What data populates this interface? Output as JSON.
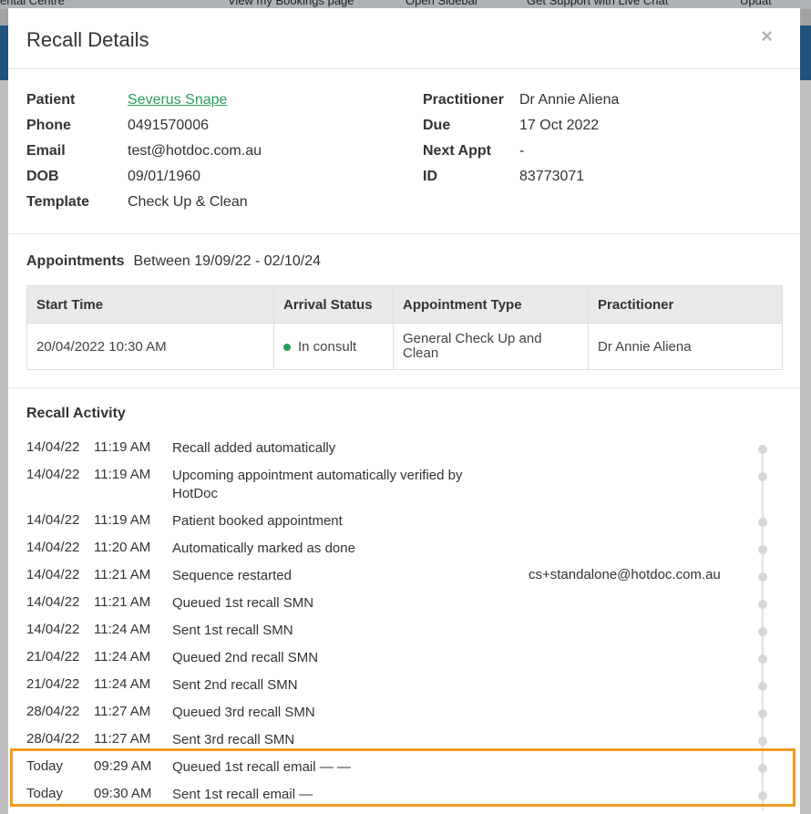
{
  "background": {
    "top_items": [
      "ental Centre",
      "View my Bookings page",
      "Open Sidebar",
      "Get Support with Live Chat",
      "Updat"
    ]
  },
  "modal": {
    "title": "Recall Details",
    "close_icon": "×"
  },
  "details": {
    "left": [
      {
        "label": "Patient",
        "value": "Severus Snape",
        "is_link": true
      },
      {
        "label": "Phone",
        "value": "0491570006"
      },
      {
        "label": "Email",
        "value": "test@hotdoc.com.au"
      },
      {
        "label": "DOB",
        "value": "09/01/1960"
      },
      {
        "label": "Template",
        "value": "Check Up & Clean"
      }
    ],
    "right": [
      {
        "label": "Practitioner",
        "value": "Dr Annie Aliena"
      },
      {
        "label": "Due",
        "value": "17 Oct 2022"
      },
      {
        "label": "Next Appt",
        "value": "-"
      },
      {
        "label": "ID",
        "value": "83773071"
      }
    ]
  },
  "appointments": {
    "heading": "Appointments",
    "range": "Between 19/09/22 - 02/10/24",
    "columns": [
      "Start Time",
      "Arrival Status",
      "Appointment Type",
      "Practitioner"
    ],
    "rows": [
      {
        "start": "20/04/2022 10:30 AM",
        "status": "In consult",
        "type": "General Check Up and Clean",
        "practitioner": "Dr Annie Aliena"
      }
    ],
    "status_color": "#2a9d5c"
  },
  "activity": {
    "heading": "Recall Activity",
    "rows": [
      {
        "date": "14/04/22",
        "time": "11:19 AM",
        "desc": "Recall added automatically",
        "user": ""
      },
      {
        "date": "14/04/22",
        "time": "11:19 AM",
        "desc": "Upcoming appointment automatically verified by HotDoc",
        "user": ""
      },
      {
        "date": "14/04/22",
        "time": "11:19 AM",
        "desc": "Patient booked appointment",
        "user": ""
      },
      {
        "date": "14/04/22",
        "time": "11:20 AM",
        "desc": "Automatically marked as done",
        "user": ""
      },
      {
        "date": "14/04/22",
        "time": "11:21 AM",
        "desc": "Sequence restarted",
        "user": "cs+standalone@hotdoc.com.au"
      },
      {
        "date": "14/04/22",
        "time": "11:21 AM",
        "desc": "Queued 1st recall SMN",
        "user": ""
      },
      {
        "date": "14/04/22",
        "time": "11:24 AM",
        "desc": "Sent 1st recall SMN",
        "user": ""
      },
      {
        "date": "21/04/22",
        "time": "11:24 AM",
        "desc": "Queued 2nd recall SMN",
        "user": ""
      },
      {
        "date": "21/04/22",
        "time": "11:24 AM",
        "desc": "Sent 2nd recall SMN",
        "user": ""
      },
      {
        "date": "28/04/22",
        "time": "11:27 AM",
        "desc": "Queued 3rd recall SMN",
        "user": ""
      },
      {
        "date": "28/04/22",
        "time": "11:27 AM",
        "desc": "Sent 3rd recall SMN",
        "user": ""
      },
      {
        "date": "Today",
        "time": "09:29 AM",
        "desc": "Queued 1st recall email — —",
        "user": ""
      },
      {
        "date": "Today",
        "time": "09:30 AM",
        "desc": "Sent 1st recall email —",
        "user": ""
      }
    ],
    "highlight_color": "#f39a1e"
  }
}
